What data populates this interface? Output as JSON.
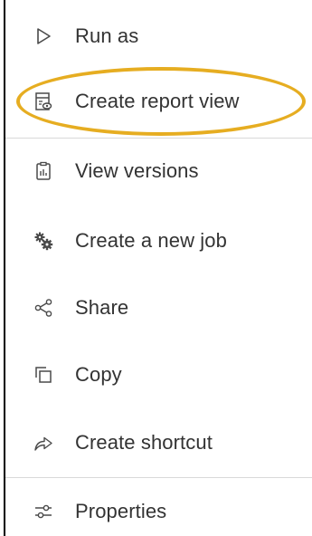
{
  "menu": {
    "items": [
      {
        "label": "Run as",
        "icon": "play-outline-icon"
      },
      {
        "label": "Create report view",
        "icon": "report-view-icon"
      },
      {
        "label": "View versions",
        "icon": "versions-icon"
      },
      {
        "label": "Create a new job",
        "icon": "gears-icon"
      },
      {
        "label": "Share",
        "icon": "share-icon"
      },
      {
        "label": "Copy",
        "icon": "copy-icon"
      },
      {
        "label": "Create shortcut",
        "icon": "shortcut-arrow-icon"
      },
      {
        "label": "Properties",
        "icon": "sliders-icon"
      }
    ]
  },
  "colors": {
    "highlight_ring": "#e6ad21",
    "text": "#333333",
    "icon": "#4a4a4a",
    "divider": "#d9d9d9"
  }
}
